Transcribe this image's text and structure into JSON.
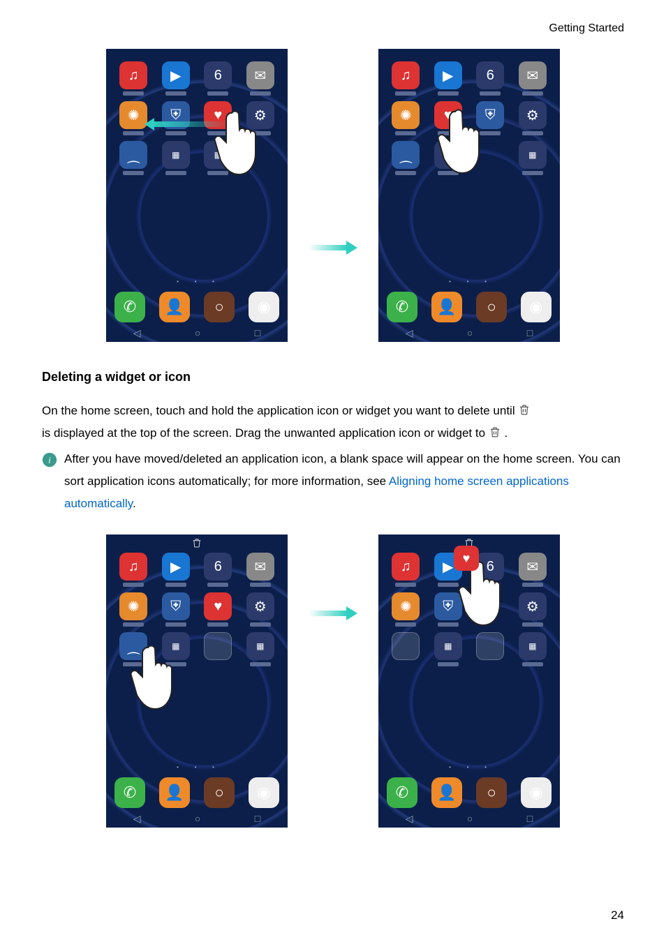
{
  "header": {
    "section": "Getting Started"
  },
  "heading": "Deleting a widget or icon",
  "para": {
    "p1a": "On the home screen, touch and hold the application icon or widget you want to delete until ",
    "p1b": "is displayed at the top of the screen. Drag the unwanted application icon or widget to ",
    "p1c": " ."
  },
  "info": {
    "t1": "After you have moved/deleted an application icon, a blank space will appear on the home screen. You can sort application icons automatically; for more information, see ",
    "link": "Aligning home screen applications automatically",
    "t2": "."
  },
  "phone": {
    "apps_row1": [
      "♫",
      "▶",
      "6",
      "✉"
    ],
    "apps_row2": [
      "✺",
      "⛨",
      "♥",
      "⚙"
    ],
    "apps_row3": [
      "⁔",
      "▦",
      "",
      ""
    ],
    "dock": [
      "✆",
      "👤",
      "○",
      "◉"
    ],
    "nav": [
      "◁",
      "○",
      "□"
    ]
  },
  "pageNumber": "24"
}
